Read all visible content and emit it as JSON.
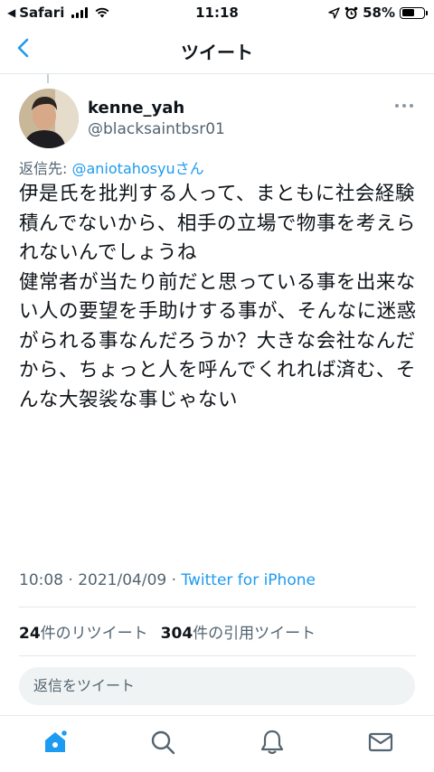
{
  "status_bar": {
    "carrier": "Safari",
    "time": "11:18",
    "battery": "58%",
    "battery_level": 0.58
  },
  "nav": {
    "title": "ツイート"
  },
  "tweet": {
    "display_name": "kenne_yah",
    "handle": "@blacksaintbsr01",
    "reply_prefix": "返信先: ",
    "reply_mention": "@aniotahosyuさん",
    "text": "伊是氏を批判する人って、まともに社会経験積んでないから、相手の立場で物事を考えられないんでしょうね\n健常者が当たり前だと思っている事を出来ない人の要望を手助けする事が、そんなに迷惑がられる事なんだろうか？大きな会社なんだから、ちょっと人を呼んでくれれば済む、そんな大袈裟な事じゃない",
    "time": "10:08",
    "separator": " · ",
    "date": "2021/04/09",
    "source": "Twitter for iPhone"
  },
  "stats": {
    "retweets_count": "24",
    "retweets_label": "件のリツイート",
    "quotes_count": "304",
    "quotes_label": "件の引用ツイート"
  },
  "reply_box": {
    "placeholder": "返信をツイート"
  },
  "tab_bar": {
    "active_color": "#1d9bf0",
    "icons": [
      "home-icon",
      "search-icon",
      "bell-icon",
      "mail-icon"
    ]
  }
}
